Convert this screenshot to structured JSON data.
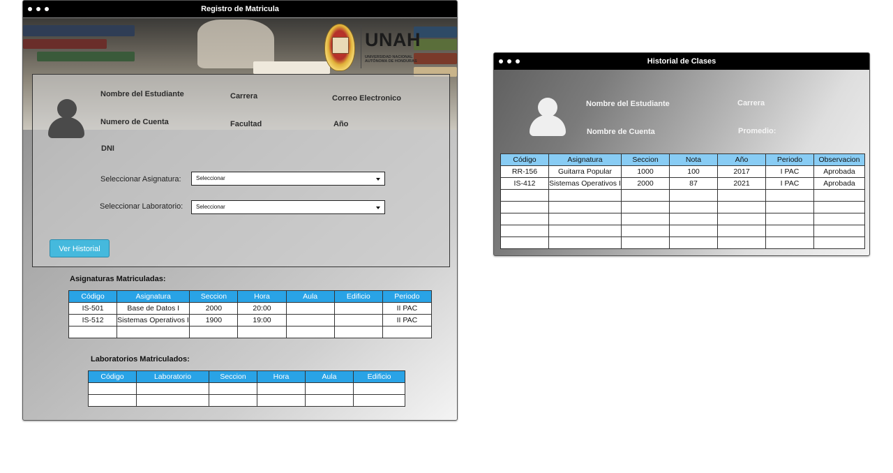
{
  "win1": {
    "title": "Registro de Matricula",
    "unah": {
      "name": "UNAH",
      "subtitle_line1": "UNIVERSIDAD NACIONAL",
      "subtitle_line2": "AUTÓNOMA DE HONDURAS"
    },
    "student": {
      "nombre_label": "Nombre del Estudiante",
      "carrera_label": "Carrera",
      "correo_label": "Correo Electronico",
      "cuenta_label": "Numero de Cuenta",
      "facultad_label": "Facultad",
      "anio_label": "Año",
      "dni_label": "DNI"
    },
    "asignatura_label": "Seleccionar Asignatura:",
    "asignatura_value": "Seleccionar",
    "laboratorio_label": "Seleccionar Laboratorio:",
    "laboratorio_value": "Seleccionar",
    "ver_historial": "Ver Historial",
    "asignaturas": {
      "title": "Asignaturas Matriculadas:",
      "headers": [
        "Código",
        "Asignatura",
        "Seccion",
        "Hora",
        "Aula",
        "Edificio",
        "Periodo"
      ],
      "rows": [
        [
          "IS-501",
          "Base de Datos I",
          "2000",
          "20:00",
          "",
          "",
          "II PAC"
        ],
        [
          "IS-512",
          "Sistemas Operativos II",
          "1900",
          "19:00",
          "",
          "",
          "II PAC"
        ],
        [
          "",
          "",
          "",
          "",
          "",
          "",
          ""
        ]
      ]
    },
    "laboratorios": {
      "title": "Laboratorios Matriculados:",
      "headers": [
        "Código",
        "Laboratorio",
        "Seccion",
        "Hora",
        "Aula",
        "Edificio"
      ],
      "rows": [
        [
          "",
          "",
          "",
          "",
          "",
          ""
        ],
        [
          "",
          "",
          "",
          "",
          "",
          ""
        ]
      ]
    }
  },
  "win2": {
    "title": "Historial de Clases",
    "nombre_label": "Nombre del Estudiante",
    "carrera_label": "Carrera",
    "cuenta_label": "Nombre de Cuenta",
    "promedio_label": "Promedio:",
    "historial": {
      "headers": [
        "Código",
        "Asignatura",
        "Seccion",
        "Nota",
        "Año",
        "Periodo",
        "Observacion"
      ],
      "rows": [
        [
          "RR-156",
          "Guitarra Popular",
          "1000",
          "100",
          "2017",
          "I PAC",
          "Aprobada"
        ],
        [
          "IS-412",
          "Sistemas Operativos I",
          "2000",
          "87",
          "2021",
          "I PAC",
          "Aprobada"
        ],
        [
          "",
          "",
          "",
          "",
          "",
          "",
          ""
        ],
        [
          "",
          "",
          "",
          "",
          "",
          "",
          ""
        ],
        [
          "",
          "",
          "",
          "",
          "",
          "",
          ""
        ],
        [
          "",
          "",
          "",
          "",
          "",
          "",
          ""
        ],
        [
          "",
          "",
          "",
          "",
          "",
          "",
          ""
        ]
      ]
    }
  },
  "colors": {
    "titlebar": "#000000",
    "table_header_1": "#29a3e6",
    "table_header_2": "#88ccf4",
    "button": "#45b9dd"
  },
  "icons": [
    "user-avatar-icon",
    "dropdown-caret-icon",
    "window-dots-icon",
    "unah-seal-icon"
  ]
}
